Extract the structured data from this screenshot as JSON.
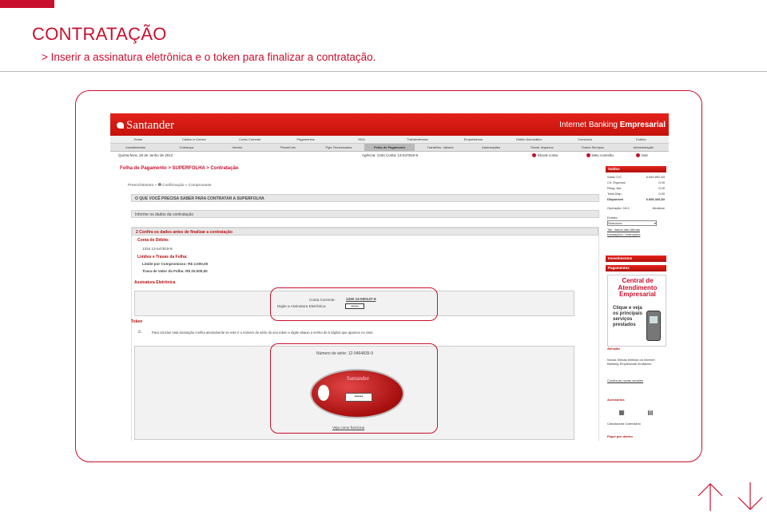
{
  "slide": {
    "title": "CONTRATAÇÃO",
    "subtitle": "> Inserir a assinatura eletrônica e o token para finalizar a contratação."
  },
  "browser": {
    "brand": "Santander",
    "banner_prefix": "Internet Banking ",
    "banner_bold": "Empresarial",
    "nav_primary": [
      "Home",
      "Cânbio e Comex",
      "Conta Corrente",
      "Pagamentos",
      "DDA",
      "Transferências",
      "Empréstimos",
      "Débito Automático",
      "Consórcio",
      "Cotões"
    ],
    "nav_secondary": [
      "Investimentos",
      "Cobrança",
      "Vendor",
      "Fiscal/Leis",
      "Pgto Terceirizados",
      "Folha de Pagamento",
      "Transfhim. Valores",
      "Autorizações",
      "Transf. Arquivos",
      "Outros Serviços",
      "Administração"
    ],
    "nav_secondary_active": 5,
    "date": "Quinta-feira, 28 de Junho de 2012",
    "agency": "Agência: 1334   Conta: 13-547819-9",
    "internet_banking_link": "Ebook conta",
    "services_link": "Meu conexão",
    "exit_link": "Sair",
    "page_heading": "Folha de Pagamento > SUPERFOLHA > Contratação",
    "steps": "Preenchimento  »  ❷ Confirmação  »  Comprovante",
    "info_bar": "O QUE VOCÊ PRECISA SABER PARA CONTRATAR A SUPERFOLHA",
    "step1": "Informe os dados da contratação",
    "step2": "2  Confira os dados antes de finalizar a contratação",
    "debit_label": "Conta de Débito:",
    "debit_value": "1334 13-547819-9",
    "limits_label": "Limites e Travas da Folha:",
    "limit_line": "Limite por Compromisso: R$ 2.000,00",
    "lock_line": "Trava de Valor da Folha: R$ 20.000,00",
    "signature_label": "Assinatura Eletrônica",
    "account_label": "Conta Corrente:",
    "account_value": "1330 13-000137-9",
    "signature_prompt": "Digite a Assinatura Eletrônica:",
    "signature_value": "••••••",
    "token_label": "Token",
    "token_instruction": "Para concluir esta transação confira atentamente se este é o número de série do seu token e digite abaixo a senha de 6 dígitos que aparece no visor.",
    "serial_label": "Número de série: 12-0464835-9",
    "token_brand": "Santander",
    "token_value": "••••••",
    "token_help": "Veja como funciona"
  },
  "sidebar": {
    "balance_title": "Saldos",
    "rows": [
      {
        "label": "Saldo C/C",
        "value": "6.649.892,83"
      },
      {
        "label": "Ch. Especial",
        "value": "0,00"
      },
      {
        "label": "Resg. Aut.",
        "value": "0,00"
      },
      {
        "label": "Total Disp.",
        "value": "0,00"
      },
      {
        "label": "Disponível",
        "value": "6.666.336,83"
      }
    ],
    "operation": "Operação: 18:4",
    "refresh": "Atualizar",
    "extract_label": "Extrato",
    "select_value": "Selecione",
    "links": [
      "Tab. dados das últimas",
      "transações / Instruções"
    ],
    "invest_title": "Investimentos",
    "payments_title": "Pagamentos",
    "central_title": "Central de Atendimento Empresarial",
    "central_sub": "Clique e veja os principais serviços prestados",
    "attention": "Atenção",
    "attention_text": "Novas Sinhas eletivas do Internet Banking Empresarial mudaram.",
    "attention_link": "Confira as novas versões",
    "accessories": "Acessórios",
    "calc": "Calculadora  Calendário",
    "fique": "Fique por dentro"
  },
  "colors": {
    "accent": "#c8102e",
    "brand_red": "#e4231b"
  }
}
